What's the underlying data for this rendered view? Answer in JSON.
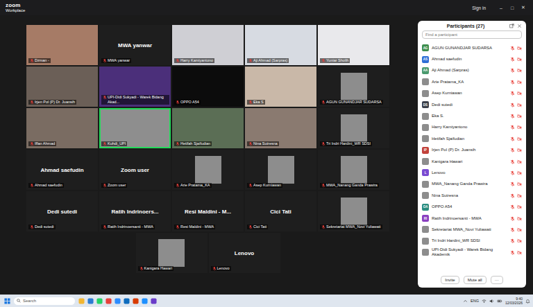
{
  "window": {
    "logo": "zoom",
    "product": "Workplace",
    "sign_in": "Sign in",
    "controls": [
      "–",
      "□",
      "✕"
    ]
  },
  "gallery": {
    "rows": [
      [
        {
          "kind": "video",
          "label": "Dzman -",
          "muted": true,
          "active": false
        },
        {
          "kind": "name",
          "name": "MWA yanwar",
          "label": "MWA yanwar",
          "muted": true,
          "active": false
        },
        {
          "kind": "video",
          "label": "Harry Kamiyantono",
          "muted": true,
          "active": false
        },
        {
          "kind": "video",
          "label": "Aji Ahmad (Sarpras)",
          "muted": true,
          "active": false
        },
        {
          "kind": "video",
          "label": "Yuniar Sholih",
          "muted": true,
          "active": false
        }
      ],
      [
        {
          "kind": "video",
          "label": "Irjen Pol (P) Dr. Juansih",
          "muted": true,
          "active": false
        },
        {
          "kind": "video",
          "label": "UPI-Didi Sukyadi - Warek Bidang Akad...",
          "muted": true,
          "active": false
        },
        {
          "kind": "blank",
          "label": "OPPO A54",
          "muted": true,
          "active": false
        },
        {
          "kind": "video",
          "label": "Eka S",
          "muted": true,
          "active": false
        },
        {
          "kind": "picture",
          "label": "AGUN GUNANDJAR SUDARSA",
          "muted": true,
          "active": false
        }
      ],
      [
        {
          "kind": "video",
          "label": "Iffan Ahmad",
          "muted": true,
          "active": false
        },
        {
          "kind": "video",
          "label": "Kuhdi_UPI",
          "muted": true,
          "active": true
        },
        {
          "kind": "video",
          "label": "Hetifah Sjaifudian",
          "muted": true,
          "active": false
        },
        {
          "kind": "video",
          "label": "Nina Sutresna",
          "muted": true,
          "active": false
        },
        {
          "kind": "picture",
          "label": "Tri Indri Hardini_WR SDSI",
          "muted": true,
          "active": false
        }
      ],
      [
        {
          "kind": "name",
          "name": "Ahmad saefudin",
          "label": "Ahmad saefudin",
          "muted": true,
          "active": false
        },
        {
          "kind": "name",
          "name": "Zoom user",
          "label": "Zoom user",
          "muted": true,
          "active": false
        },
        {
          "kind": "picture",
          "label": "Arie Pratama_KA",
          "muted": true,
          "active": false
        },
        {
          "kind": "picture",
          "label": "Asep Kurniawan",
          "muted": true,
          "active": false
        },
        {
          "kind": "picture",
          "label": "MWA_Nanang Ganda Prawira",
          "muted": true,
          "active": false
        }
      ],
      [
        {
          "kind": "name",
          "name": "Dedi sutedi",
          "label": "Dedi sutedi",
          "muted": true,
          "active": false
        },
        {
          "kind": "name",
          "name": "Ratih Indrinoers...",
          "label": "Ratih Indrinoersanti - MWA",
          "muted": true,
          "active": false
        },
        {
          "kind": "name",
          "name": "Resi Maldini - M...",
          "label": "Resi Maldini - MWA",
          "muted": true,
          "active": false
        },
        {
          "kind": "name",
          "name": "Cici Tati",
          "label": "Cici Tati",
          "muted": true,
          "active": false
        },
        {
          "kind": "picture",
          "label": "Sekretariat MWA_Novi Yuliawati",
          "muted": true,
          "active": false
        }
      ],
      [
        {
          "kind": "picture",
          "label": "Kanigara Hawari",
          "muted": true,
          "active": false
        },
        {
          "kind": "name",
          "name": "Lenovo",
          "label": "Lenovo",
          "muted": true,
          "active": false
        }
      ]
    ]
  },
  "participants": {
    "title": "Participants (27)",
    "search": {
      "placeholder": "Find a participant"
    },
    "items": [
      {
        "name": "AGUN GUNANDJAR SUDARSA",
        "kind": "initials",
        "initials": "AG",
        "color": "#3e8e4e",
        "muted": true,
        "video": false
      },
      {
        "name": "Ahmad saefudin",
        "kind": "initials",
        "initials": "AS",
        "color": "#2f6fd6",
        "muted": true,
        "video": false
      },
      {
        "name": "Aji Ahmad (Sarpras)",
        "kind": "initials",
        "initials": "AA",
        "color": "#4a9a6e",
        "muted": true,
        "video": false
      },
      {
        "name": "Arie Pratama_KA",
        "kind": "photo",
        "muted": true,
        "video": false
      },
      {
        "name": "Asep Kurniawan",
        "kind": "photo",
        "muted": true,
        "video": false
      },
      {
        "name": "Dedi sutedi",
        "kind": "initials",
        "initials": "DS",
        "color": "#3a3f4a",
        "muted": true,
        "video": false
      },
      {
        "name": "Eka S.",
        "kind": "photo",
        "muted": true,
        "video": false
      },
      {
        "name": "Harry Kamiyantono",
        "kind": "photo",
        "muted": true,
        "video": false
      },
      {
        "name": "Hetifah Sjaifudian",
        "kind": "photo",
        "muted": true,
        "video": false
      },
      {
        "name": "Irjen Pol (P) Dr. Juansih",
        "kind": "initials",
        "initials": "IP",
        "color": "#c2423b",
        "muted": true,
        "video": false
      },
      {
        "name": "Kanigara Hawari",
        "kind": "photo",
        "muted": true,
        "video": false
      },
      {
        "name": "Lenovo",
        "kind": "initials",
        "initials": "L",
        "color": "#7a4bd1",
        "muted": true,
        "video": false
      },
      {
        "name": "MWA_Nanang Ganda Prawira",
        "kind": "photo",
        "muted": true,
        "video": false
      },
      {
        "name": "Nina Sutresna",
        "kind": "photo",
        "muted": true,
        "video": false
      },
      {
        "name": "OPPO A54",
        "kind": "initials",
        "initials": "OA",
        "color": "#2a8c7f",
        "muted": true,
        "video": false
      },
      {
        "name": "Ratih Indrinoersanti - MWA",
        "kind": "initials",
        "initials": "RI",
        "color": "#8a3fc0",
        "muted": true,
        "video": false
      },
      {
        "name": "Sekretariat MWA_Novi Yuliawati",
        "kind": "photo",
        "muted": true,
        "video": false
      },
      {
        "name": "Tri Indri Hardini_WR SDSI",
        "kind": "photo",
        "muted": true,
        "video": false
      },
      {
        "name": "UPI-Didi Sukyadi - Warek Bidang Akademik",
        "kind": "photo",
        "muted": true,
        "video": false
      }
    ],
    "buttons": [
      "Invite",
      "Mute all",
      "···"
    ]
  },
  "taskbar": {
    "search": "Search",
    "lang": "ENG",
    "time": "9:40",
    "date": "12/03/2026"
  }
}
